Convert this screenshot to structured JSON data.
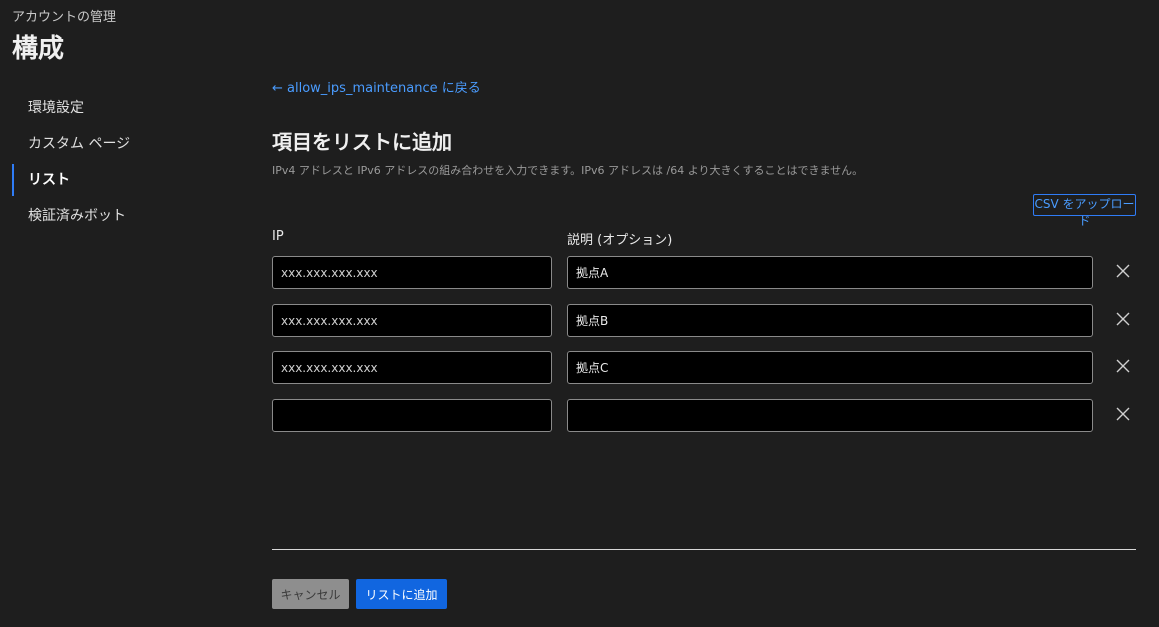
{
  "header": {
    "section": "アカウントの管理",
    "title": "構成"
  },
  "sidebar": {
    "items": [
      {
        "label": "環境設定",
        "active": false
      },
      {
        "label": "カスタム ページ",
        "active": false
      },
      {
        "label": "リスト",
        "active": true
      },
      {
        "label": "検証済みボット",
        "active": false
      }
    ]
  },
  "main": {
    "back_link": "← allow_ips_maintenance に戻る",
    "title": "項目をリストに追加",
    "description": "IPv4 アドレスと IPv6 アドレスの組み合わせを入力できます。IPv6 アドレスは /64 より大きくすることはできません。",
    "csv_button": "CSV をアップロード",
    "columns": {
      "ip": "IP",
      "description": "説明 (オプション)"
    },
    "rows": [
      {
        "ip_placeholder": "xxx.xxx.xxx.xxx",
        "ip": "",
        "description": "拠点A"
      },
      {
        "ip_placeholder": "xxx.xxx.xxx.xxx",
        "ip": "",
        "description": "拠点B"
      },
      {
        "ip_placeholder": "xxx.xxx.xxx.xxx",
        "ip": "",
        "description": "拠点C"
      },
      {
        "ip_placeholder": "",
        "ip": "",
        "description": ""
      }
    ],
    "remove_icon": "close-icon",
    "cancel_button": "キャンセル",
    "add_button": "リストに追加"
  },
  "colors": {
    "background": "#1e1e1e",
    "accent": "#2f7cf6",
    "link": "#4a9cff",
    "primary_button": "#1166e0",
    "disabled_button": "#8e8e8e"
  }
}
